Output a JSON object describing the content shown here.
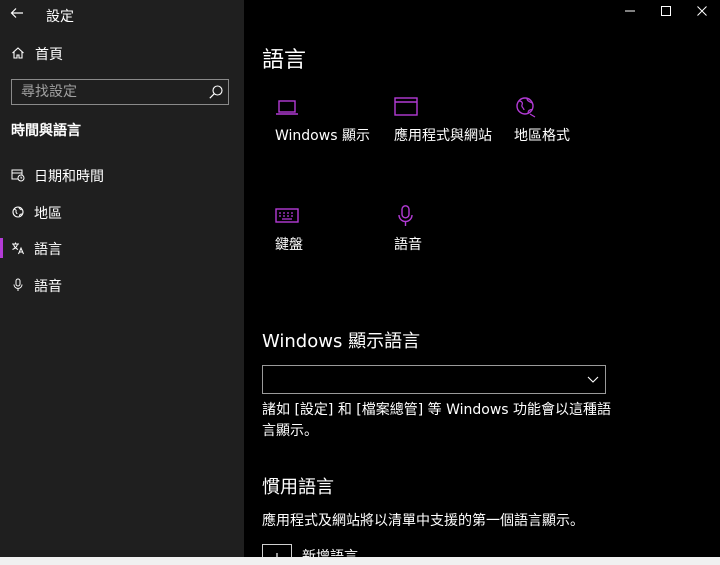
{
  "app": {
    "title": "設定"
  },
  "colors": {
    "accent": "#b33bd6",
    "sidebar_bg": "#1f1f1f",
    "main_bg": "#000000"
  },
  "sidebar": {
    "home_label": "首頁",
    "search_placeholder": "尋找設定",
    "section_title": "時間與語言",
    "items": [
      {
        "label": "日期和時間",
        "icon": "calendar-clock-icon",
        "active": false
      },
      {
        "label": "地區",
        "icon": "globe-icon",
        "active": false
      },
      {
        "label": "語言",
        "icon": "language-icon",
        "active": true
      },
      {
        "label": "語音",
        "icon": "microphone-icon",
        "active": false
      }
    ]
  },
  "main": {
    "title": "語言",
    "tiles": [
      {
        "label": "Windows 顯示",
        "icon": "laptop-icon"
      },
      {
        "label": "應用程式與網站",
        "icon": "app-window-icon"
      },
      {
        "label": "地區格式",
        "icon": "globe-icon"
      },
      {
        "label": "鍵盤",
        "icon": "keyboard-icon"
      },
      {
        "label": "語音",
        "icon": "microphone-icon"
      }
    ],
    "display_language": {
      "heading": "Windows 顯示語言",
      "selected": "",
      "description": "諸如 [設定] 和 [檔案總管] 等 Windows 功能會以這種語言顯示。"
    },
    "preferred": {
      "heading": "慣用語言",
      "description": "應用程式及網站將以清單中支援的第一個語言顯示。",
      "add_label": "新增語言"
    }
  }
}
